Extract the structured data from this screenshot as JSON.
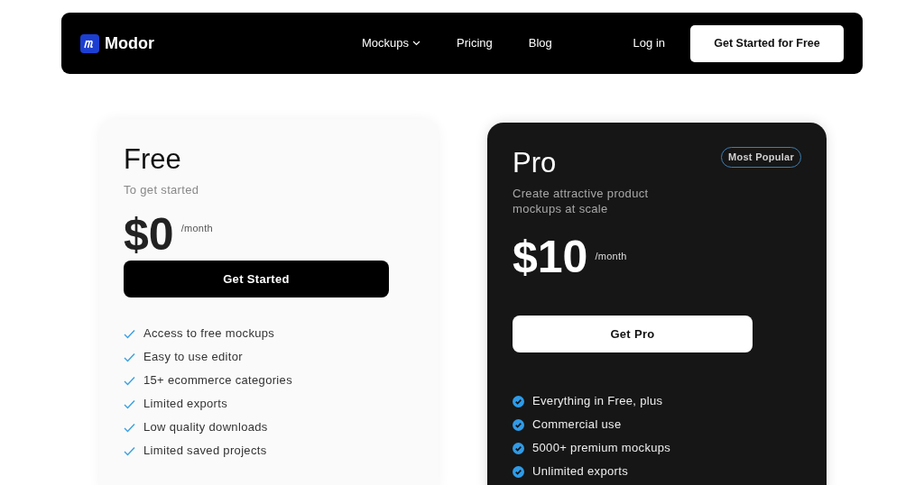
{
  "nav": {
    "brand": "Modor",
    "links": [
      {
        "label": "Mockups",
        "kind": "dropdown"
      },
      {
        "label": "Pricing",
        "kind": "link"
      },
      {
        "label": "Blog",
        "kind": "link"
      }
    ],
    "login": "Log in",
    "cta": "Get Started for Free"
  },
  "plans": [
    {
      "kind": "light",
      "name": "Free",
      "subtitle": "To get started",
      "price": "$0",
      "period": "/month",
      "button": "Get Started",
      "features": [
        "Access to free mockups",
        "Easy to use editor",
        "15+ ecommerce categories",
        "Limited exports",
        "Low quality downloads",
        "Limited saved projects"
      ]
    },
    {
      "kind": "dark",
      "name": "Pro",
      "badge": "Most Popular",
      "subtitle": "Create attractive product mockups at scale",
      "price": "$10",
      "period": "/month",
      "button": "Get Pro",
      "features": [
        "Everything in Free, plus",
        "Commercial use",
        "5000+ premium mockups",
        "Unlimited exports"
      ]
    }
  ]
}
